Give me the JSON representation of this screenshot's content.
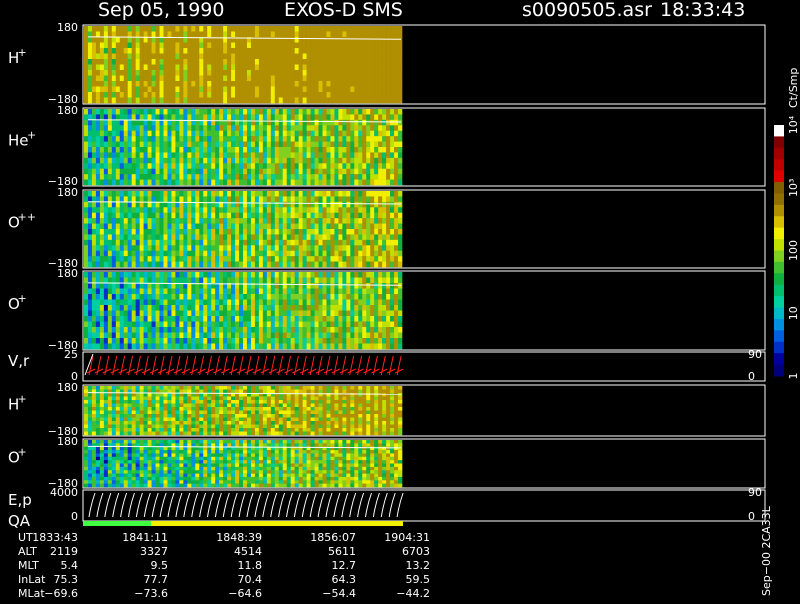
{
  "header": {
    "date": "Sep 05, 1990",
    "instrument": "EXOS-D SMS",
    "file": "s0090505.asr",
    "time": "18:33:43"
  },
  "chart_data": {
    "type": "heatmap",
    "panels": [
      {
        "label": "H",
        "sup": "+",
        "ylim": [
          -180,
          180
        ],
        "yticks": [
          "180",
          "−180"
        ]
      },
      {
        "label": "He",
        "sup": "+",
        "ylim": [
          -180,
          180
        ],
        "yticks": [
          "180",
          "−180"
        ]
      },
      {
        "label": "O",
        "sup": "++",
        "ylim": [
          -180,
          180
        ],
        "yticks": [
          "180",
          "−180"
        ]
      },
      {
        "label": "O",
        "sup": "+",
        "ylim": [
          -180,
          180
        ],
        "yticks": [
          "180",
          "−180"
        ]
      },
      {
        "label": "V,r",
        "sup": "",
        "ylim": [
          0,
          25
        ],
        "yticks": [
          "25",
          "0"
        ],
        "right_ticks": [
          "90",
          "0"
        ]
      },
      {
        "label": "H",
        "sup": "+",
        "ylim": [
          -180,
          180
        ],
        "yticks": [
          "180",
          "−180"
        ]
      },
      {
        "label": "O",
        "sup": "+",
        "ylim": [
          -180,
          180
        ],
        "yticks": [
          "180",
          "−180"
        ]
      },
      {
        "label": "E,p",
        "sup": "",
        "ylim": [
          0,
          4000
        ],
        "yticks": [
          "4000",
          "0"
        ],
        "right_ticks": [
          "90",
          "0"
        ]
      }
    ],
    "qa_label": "QA",
    "colorbar": {
      "unit": "Ct/Smp",
      "scale": "log",
      "range": [
        1,
        10000
      ],
      "labels": [
        "1",
        "10",
        "100",
        "10³",
        "10⁴"
      ],
      "colors": [
        "#00007a",
        "#00009c",
        "#0030c8",
        "#0060e0",
        "#0090e0",
        "#00b8c8",
        "#00d0a0",
        "#00c070",
        "#10b040",
        "#40c030",
        "#80d020",
        "#c0e000",
        "#f0f000",
        "#d8c000",
        "#b09000",
        "#907000",
        "#806000",
        "#e00000",
        "#c00000",
        "#a00000",
        "#800000",
        "#ffffff"
      ]
    },
    "time_axis": {
      "rows": [
        {
          "name": "UT",
          "values": [
            "1833:43",
            "1841:11",
            "1848:39",
            "1856:07",
            "1904:31"
          ]
        },
        {
          "name": "ALT",
          "values": [
            "2119",
            "3327",
            "4514",
            "5611",
            "6703"
          ]
        },
        {
          "name": "MLT",
          "values": [
            "5.4",
            "9.5",
            "11.8",
            "12.7",
            "13.2"
          ]
        },
        {
          "name": "InLat",
          "values": [
            "75.3",
            "77.7",
            "70.4",
            "64.3",
            "59.5"
          ]
        },
        {
          "name": "MLat",
          "values": [
            "−69.6",
            "−73.6",
            "−64.6",
            "−54.4",
            "−44.2"
          ]
        }
      ]
    },
    "footer_stamp": "Sep−00 2CA33L"
  }
}
